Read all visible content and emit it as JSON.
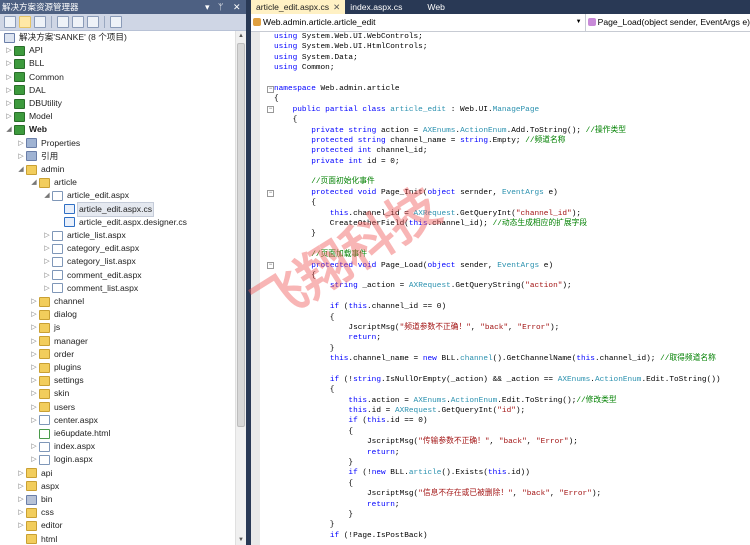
{
  "explorer": {
    "title": "解决方案资源管理器",
    "controls": [
      "▾",
      "ᛘ",
      "✕"
    ],
    "toolbar": [
      "properties-icon",
      "show-all-files-icon",
      "refresh-icon",
      "view-code-icon",
      "view-designer-icon",
      "class-view-icon",
      "web-config-icon"
    ],
    "items": [
      {
        "label": "解决方案'SANKE' (8 个项目)",
        "icon": "sol",
        "level": 0,
        "exp": ""
      },
      {
        "label": "API",
        "icon": "proj",
        "level": 0,
        "exp": "▷"
      },
      {
        "label": "BLL",
        "icon": "proj",
        "level": 0,
        "exp": "▷"
      },
      {
        "label": "Common",
        "icon": "proj",
        "level": 0,
        "exp": "▷"
      },
      {
        "label": "DAL",
        "icon": "proj",
        "level": 0,
        "exp": "▷"
      },
      {
        "label": "DBUtility",
        "icon": "proj",
        "level": 0,
        "exp": "▷"
      },
      {
        "label": "Model",
        "icon": "proj",
        "level": 0,
        "exp": "▷"
      },
      {
        "label": "Web",
        "icon": "proj",
        "level": 0,
        "exp": "◢",
        "bold": true
      },
      {
        "label": "Properties",
        "icon": "props",
        "level": 1,
        "exp": "▷"
      },
      {
        "label": "引用",
        "icon": "props",
        "level": 1,
        "exp": "▷"
      },
      {
        "label": "admin",
        "icon": "folder",
        "level": 1,
        "exp": "◢"
      },
      {
        "label": "article",
        "icon": "folder",
        "level": 2,
        "exp": "◢"
      },
      {
        "label": "article_edit.aspx",
        "icon": "page",
        "level": 3,
        "exp": "◢"
      },
      {
        "label": "article_edit.aspx.cs",
        "icon": "cs",
        "level": 4,
        "exp": "",
        "selected": true
      },
      {
        "label": "article_edit.aspx.designer.cs",
        "icon": "cs",
        "level": 4,
        "exp": ""
      },
      {
        "label": "article_list.aspx",
        "icon": "page",
        "level": 3,
        "exp": "▷"
      },
      {
        "label": "category_edit.aspx",
        "icon": "page",
        "level": 3,
        "exp": "▷"
      },
      {
        "label": "category_list.aspx",
        "icon": "page",
        "level": 3,
        "exp": "▷"
      },
      {
        "label": "comment_edit.aspx",
        "icon": "page",
        "level": 3,
        "exp": "▷"
      },
      {
        "label": "comment_list.aspx",
        "icon": "page",
        "level": 3,
        "exp": "▷"
      },
      {
        "label": "channel",
        "icon": "folder",
        "level": 2,
        "exp": "▷"
      },
      {
        "label": "dialog",
        "icon": "folder",
        "level": 2,
        "exp": "▷"
      },
      {
        "label": "js",
        "icon": "folder",
        "level": 2,
        "exp": "▷"
      },
      {
        "label": "manager",
        "icon": "folder",
        "level": 2,
        "exp": "▷"
      },
      {
        "label": "order",
        "icon": "folder",
        "level": 2,
        "exp": "▷"
      },
      {
        "label": "plugins",
        "icon": "folder",
        "level": 2,
        "exp": "▷"
      },
      {
        "label": "settings",
        "icon": "folder",
        "level": 2,
        "exp": "▷"
      },
      {
        "label": "skin",
        "icon": "folder",
        "level": 2,
        "exp": "▷"
      },
      {
        "label": "users",
        "icon": "folder",
        "level": 2,
        "exp": "▷"
      },
      {
        "label": "center.aspx",
        "icon": "page",
        "level": 2,
        "exp": "▷"
      },
      {
        "label": "ie6update.html",
        "icon": "html",
        "level": 2,
        "exp": ""
      },
      {
        "label": "index.aspx",
        "icon": "page",
        "level": 2,
        "exp": "▷"
      },
      {
        "label": "login.aspx",
        "icon": "page",
        "level": 2,
        "exp": "▷"
      },
      {
        "label": "api",
        "icon": "folder",
        "level": 1,
        "exp": "▷"
      },
      {
        "label": "aspx",
        "icon": "folder",
        "level": 1,
        "exp": "▷"
      },
      {
        "label": "bin",
        "icon": "bin",
        "level": 1,
        "exp": "▷"
      },
      {
        "label": "css",
        "icon": "folder",
        "level": 1,
        "exp": "▷"
      },
      {
        "label": "editor",
        "icon": "folder",
        "level": 1,
        "exp": "▷"
      },
      {
        "label": "html",
        "icon": "folder",
        "level": 1,
        "exp": ""
      }
    ]
  },
  "tabs": [
    {
      "label": "article_edit.aspx.cs",
      "active": true,
      "close": "✕"
    },
    {
      "label": "index.aspx.cs"
    },
    {
      "label": "Web"
    }
  ],
  "nav": {
    "class_combo": "Web.admin.article.article_edit",
    "member_combo": "Page_Load(object sender, EventArgs e)"
  },
  "watermark": "飞翔科技",
  "colors": {
    "keyword": "#0000ff",
    "type": "#2b91af",
    "string": "#a31515",
    "comment": "#008000"
  },
  "code": [
    [
      [
        "k",
        "using"
      ],
      [
        "n",
        " System.Web.UI.WebControls;"
      ]
    ],
    [
      [
        "k",
        "using"
      ],
      [
        "n",
        " System.Web.UI.HtmlControls;"
      ]
    ],
    [
      [
        "k",
        "using"
      ],
      [
        "n",
        " System.Data;"
      ]
    ],
    [
      [
        "k",
        "using"
      ],
      [
        "n",
        " Common;"
      ]
    ],
    [],
    [
      [
        "k",
        "namespace"
      ],
      [
        "n",
        " Web.admin.article"
      ]
    ],
    [
      [
        "n",
        "{"
      ]
    ],
    [
      [
        "n",
        "    "
      ],
      [
        "k",
        "public partial class"
      ],
      [
        "t",
        " article_edit"
      ],
      [
        "n",
        " : Web.UI."
      ],
      [
        "t",
        "ManagePage"
      ]
    ],
    [
      [
        "n",
        "    {"
      ]
    ],
    [
      [
        "n",
        "        "
      ],
      [
        "k",
        "private string"
      ],
      [
        "n",
        " action = "
      ],
      [
        "t",
        "AXEnums"
      ],
      [
        "n",
        "."
      ],
      [
        "t",
        "ActionEnum"
      ],
      [
        "n",
        ".Add.ToString(); "
      ],
      [
        "c",
        "//操作类型"
      ]
    ],
    [
      [
        "n",
        "        "
      ],
      [
        "k",
        "protected string"
      ],
      [
        "n",
        " channel_name = "
      ],
      [
        "k",
        "string"
      ],
      [
        "n",
        ".Empty; "
      ],
      [
        "c",
        "//频道名称"
      ]
    ],
    [
      [
        "n",
        "        "
      ],
      [
        "k",
        "protected int"
      ],
      [
        "n",
        " channel_id;"
      ]
    ],
    [
      [
        "n",
        "        "
      ],
      [
        "k",
        "private int"
      ],
      [
        "n",
        " id = 0;"
      ]
    ],
    [],
    [
      [
        "n",
        "        "
      ],
      [
        "c",
        "//页面初始化事件"
      ]
    ],
    [
      [
        "n",
        "        "
      ],
      [
        "k",
        "protected void"
      ],
      [
        "n",
        " Page_Init("
      ],
      [
        "k",
        "object"
      ],
      [
        "n",
        " sernder, "
      ],
      [
        "t",
        "EventArgs"
      ],
      [
        "n",
        " e)"
      ]
    ],
    [
      [
        "n",
        "        {"
      ]
    ],
    [
      [
        "n",
        "            "
      ],
      [
        "k",
        "this"
      ],
      [
        "n",
        ".channel_id = "
      ],
      [
        "t",
        "AXRequest"
      ],
      [
        "n",
        ".GetQueryInt("
      ],
      [
        "s",
        "\"channel_id\""
      ],
      [
        "n",
        ");"
      ]
    ],
    [
      [
        "n",
        "            CreateOtherField("
      ],
      [
        "k",
        "this"
      ],
      [
        "n",
        ".channel_id); "
      ],
      [
        "c",
        "//动态生成相应的扩展字段"
      ]
    ],
    [
      [
        "n",
        "        }"
      ]
    ],
    [],
    [
      [
        "n",
        "        "
      ],
      [
        "c",
        "//页面加载事件"
      ]
    ],
    [
      [
        "n",
        "        "
      ],
      [
        "k",
        "protected void"
      ],
      [
        "n",
        " Page_Load("
      ],
      [
        "k",
        "object"
      ],
      [
        "n",
        " sender, "
      ],
      [
        "t",
        "EventArgs"
      ],
      [
        "n",
        " e)"
      ]
    ],
    [
      [
        "n",
        "        {"
      ]
    ],
    [
      [
        "n",
        "            "
      ],
      [
        "k",
        "string"
      ],
      [
        "n",
        " _action = "
      ],
      [
        "t",
        "AXRequest"
      ],
      [
        "n",
        ".GetQueryString("
      ],
      [
        "s",
        "\"action\""
      ],
      [
        "n",
        ");"
      ]
    ],
    [],
    [
      [
        "n",
        "            "
      ],
      [
        "k",
        "if"
      ],
      [
        "n",
        " ("
      ],
      [
        "k",
        "this"
      ],
      [
        "n",
        ".channel_id == 0)"
      ]
    ],
    [
      [
        "n",
        "            {"
      ]
    ],
    [
      [
        "n",
        "                JscriptMsg("
      ],
      [
        "s",
        "\"频道参数不正确！\""
      ],
      [
        "n",
        ", "
      ],
      [
        "s",
        "\"back\""
      ],
      [
        "n",
        ", "
      ],
      [
        "s",
        "\"Error\""
      ],
      [
        "n",
        ");"
      ]
    ],
    [
      [
        "n",
        "                "
      ],
      [
        "k",
        "return"
      ],
      [
        "n",
        ";"
      ]
    ],
    [
      [
        "n",
        "            }"
      ]
    ],
    [
      [
        "n",
        "            "
      ],
      [
        "k",
        "this"
      ],
      [
        "n",
        ".channel_name = "
      ],
      [
        "k",
        "new"
      ],
      [
        "n",
        " BLL."
      ],
      [
        "t",
        "channel"
      ],
      [
        "n",
        "().GetChannelName("
      ],
      [
        "k",
        "this"
      ],
      [
        "n",
        ".channel_id); "
      ],
      [
        "c",
        "//取得频道名称"
      ]
    ],
    [],
    [
      [
        "n",
        "            "
      ],
      [
        "k",
        "if"
      ],
      [
        "n",
        " (!"
      ],
      [
        "k",
        "string"
      ],
      [
        "n",
        ".IsNullOrEmpty(_action) && _action == "
      ],
      [
        "t",
        "AXEnums"
      ],
      [
        "n",
        "."
      ],
      [
        "t",
        "ActionEnum"
      ],
      [
        "n",
        ".Edit.ToString())"
      ]
    ],
    [
      [
        "n",
        "            {"
      ]
    ],
    [
      [
        "n",
        "                "
      ],
      [
        "k",
        "this"
      ],
      [
        "n",
        ".action = "
      ],
      [
        "t",
        "AXEnums"
      ],
      [
        "n",
        "."
      ],
      [
        "t",
        "ActionEnum"
      ],
      [
        "n",
        ".Edit.ToString();"
      ],
      [
        "c",
        "//修改类型"
      ]
    ],
    [
      [
        "n",
        "                "
      ],
      [
        "k",
        "this"
      ],
      [
        "n",
        ".id = "
      ],
      [
        "t",
        "AXRequest"
      ],
      [
        "n",
        ".GetQueryInt("
      ],
      [
        "s",
        "\"id\""
      ],
      [
        "n",
        ");"
      ]
    ],
    [
      [
        "n",
        "                "
      ],
      [
        "k",
        "if"
      ],
      [
        "n",
        " ("
      ],
      [
        "k",
        "this"
      ],
      [
        "n",
        ".id == 0)"
      ]
    ],
    [
      [
        "n",
        "                {"
      ]
    ],
    [
      [
        "n",
        "                    JscriptMsg("
      ],
      [
        "s",
        "\"传输参数不正确！\""
      ],
      [
        "n",
        ", "
      ],
      [
        "s",
        "\"back\""
      ],
      [
        "n",
        ", "
      ],
      [
        "s",
        "\"Error\""
      ],
      [
        "n",
        ");"
      ]
    ],
    [
      [
        "n",
        "                    "
      ],
      [
        "k",
        "return"
      ],
      [
        "n",
        ";"
      ]
    ],
    [
      [
        "n",
        "                }"
      ]
    ],
    [
      [
        "n",
        "                "
      ],
      [
        "k",
        "if"
      ],
      [
        "n",
        " (!"
      ],
      [
        "k",
        "new"
      ],
      [
        "n",
        " BLL."
      ],
      [
        "t",
        "article"
      ],
      [
        "n",
        "().Exists("
      ],
      [
        "k",
        "this"
      ],
      [
        "n",
        ".id))"
      ]
    ],
    [
      [
        "n",
        "                {"
      ]
    ],
    [
      [
        "n",
        "                    JscriptMsg("
      ],
      [
        "s",
        "\"信息不存在或已被删除！\""
      ],
      [
        "n",
        ", "
      ],
      [
        "s",
        "\"back\""
      ],
      [
        "n",
        ", "
      ],
      [
        "s",
        "\"Error\""
      ],
      [
        "n",
        ");"
      ]
    ],
    [
      [
        "n",
        "                    "
      ],
      [
        "k",
        "return"
      ],
      [
        "n",
        ";"
      ]
    ],
    [
      [
        "n",
        "                }"
      ]
    ],
    [
      [
        "n",
        "            }"
      ]
    ],
    [
      [
        "n",
        "            "
      ],
      [
        "k",
        "if"
      ],
      [
        "n",
        " (!Page.IsPostBack)"
      ]
    ]
  ],
  "fold_lines": [
    5,
    7,
    15,
    22
  ]
}
